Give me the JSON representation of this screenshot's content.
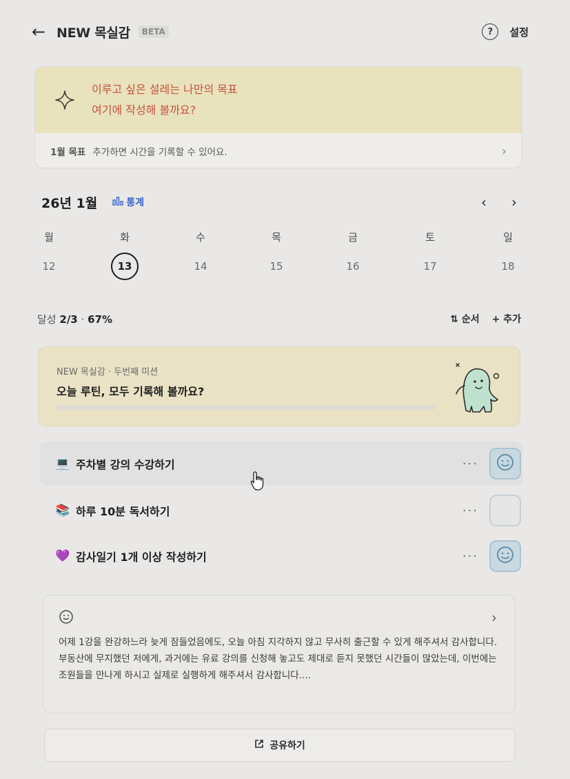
{
  "header": {
    "back_icon": "←",
    "title": "NEW 목실감",
    "badge": "BETA",
    "help_icon": "?",
    "settings_label": "설정"
  },
  "goal_card": {
    "line1": "이루고 싶은 설레는 나만의 목표",
    "line2": "여기에 작성해 볼까요?",
    "month_label": "1월 목표",
    "hint": "추가하면 시간을 기록할 수 있어요.",
    "chevron": "›"
  },
  "calendar": {
    "month_title": "26년 1월",
    "stats_label": "통계",
    "prev": "‹",
    "next": "›",
    "weekdays": [
      "월",
      "화",
      "수",
      "목",
      "금",
      "토",
      "일"
    ],
    "dates": [
      "12",
      "13",
      "14",
      "15",
      "16",
      "17",
      "18"
    ],
    "selected_index": 1
  },
  "progress": {
    "prefix": "달성",
    "count": "2/3",
    "separator": "·",
    "percent": "67%",
    "order_label": "순서",
    "add_label": "추가"
  },
  "mission": {
    "subtitle": "NEW 목실감 · 두번째 미션",
    "title": "오늘 루틴, 모두 기록해 볼까요?",
    "progress": 0
  },
  "tasks": [
    {
      "emoji": "💻",
      "label": "주차별 강의 수강하기",
      "done": true,
      "more": "···"
    },
    {
      "emoji": "📚",
      "label": "하루 10분 독서하기",
      "done": false,
      "more": "···"
    },
    {
      "emoji": "💜",
      "label": "감사일기 1개 이상 작성하기",
      "done": true,
      "more": "···"
    }
  ],
  "diary": {
    "chevron": "›",
    "paragraph1": "어제 1강을 완강하느라 늦게 잠들었음에도, 오늘 아침 지각하지 않고 무사히 출근할 수 있게 해주셔서 감사합니다.",
    "paragraph2": "부동산에 무지했던 저에게, 과거에는 유료 강의를 신청해 놓고도 제대로 듣지 못했던 시간들이 많았는데, 이번에는 조원들을 만나게 하시고 실제로 실행하게 해주셔서 감사합니다...."
  },
  "share": {
    "label": "공유하기"
  },
  "colors": {
    "goal_text": "#c4533f",
    "goal_bg": "#e8e2bd",
    "stats_link": "#3b66c9",
    "check_done_bg": "#cad9df"
  }
}
